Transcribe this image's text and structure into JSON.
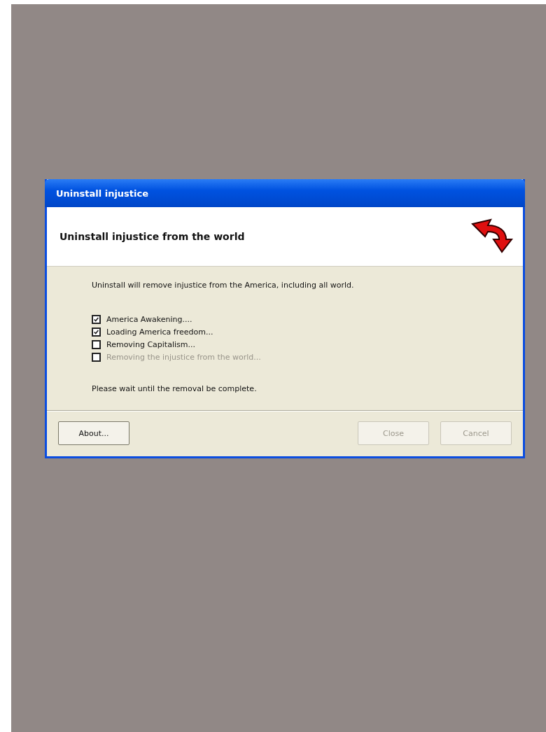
{
  "window": {
    "title": "Uninstall injustice"
  },
  "header": {
    "title": "Uninstall injustice from the world"
  },
  "intro": "Uninstall will remove injustice from the America, including all world.",
  "steps": [
    {
      "label": "America Awakening....",
      "checked": true,
      "disabled": false
    },
    {
      "label": "Loading America freedom...",
      "checked": true,
      "disabled": false
    },
    {
      "label": "Removing Capitalism...",
      "checked": false,
      "disabled": false
    },
    {
      "label": "Removing the injustice from the world...",
      "checked": false,
      "disabled": true
    }
  ],
  "status": "Please wait until the removal be complete.",
  "buttons": [
    {
      "label": "About...",
      "disabled": false
    },
    {
      "label": "Close",
      "disabled": true
    },
    {
      "label": "Cancel",
      "disabled": true
    }
  ]
}
